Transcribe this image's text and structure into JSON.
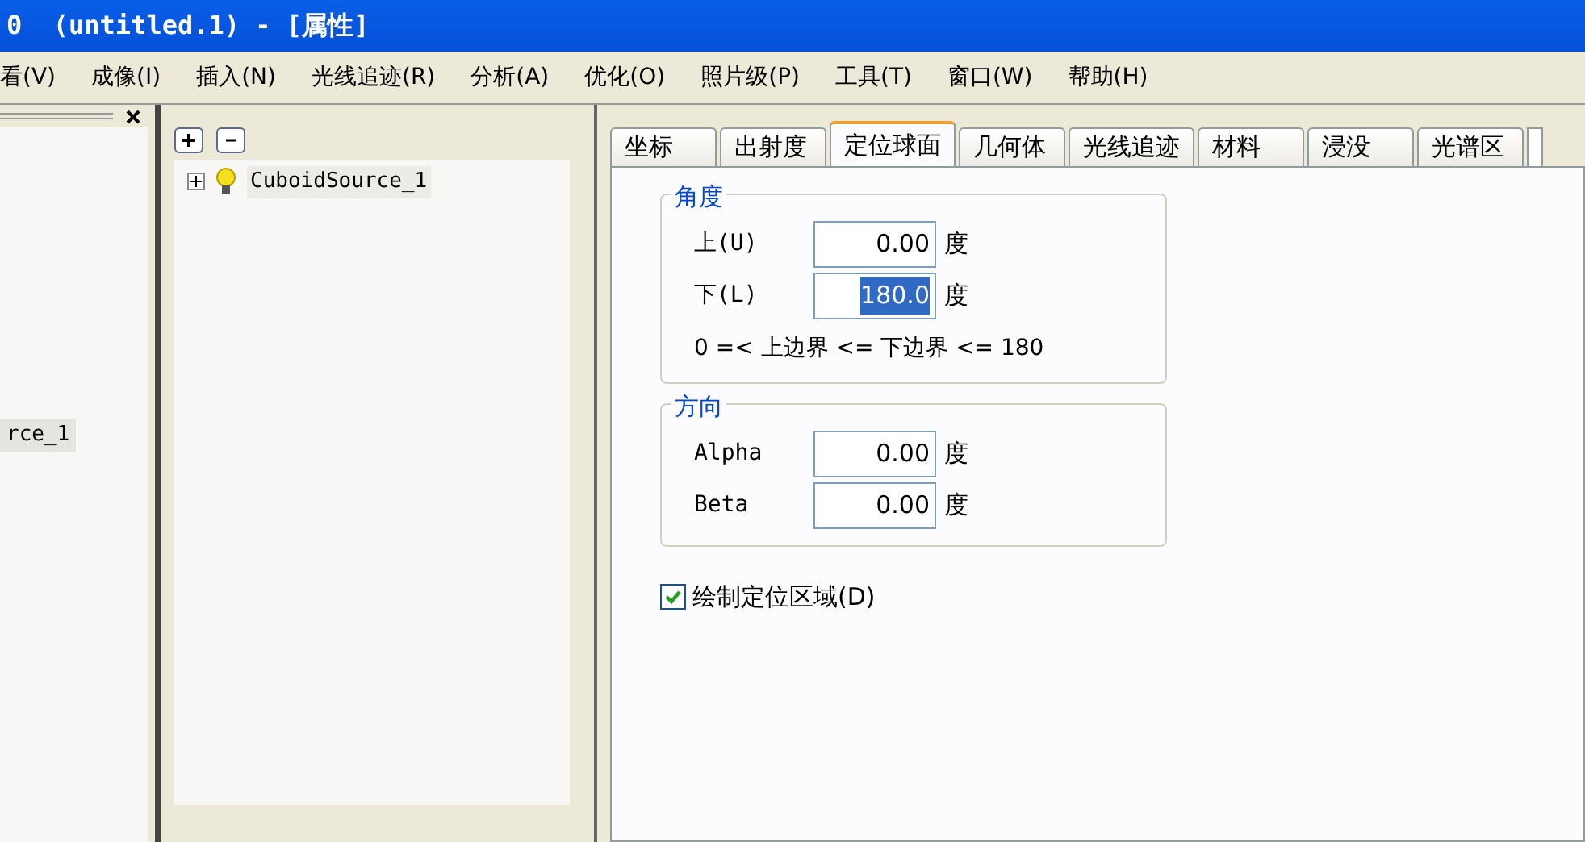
{
  "window": {
    "title": "0  (untitled.1) - [属性]"
  },
  "menu": [
    "看(V)",
    "成像(I)",
    "插入(N)",
    "光线追迹(R)",
    "分析(A)",
    "优化(O)",
    "照片级(P)",
    "工具(T)",
    "窗口(W)",
    "帮助(H)"
  ],
  "left_pane": {
    "item": "rce_1",
    "selected": true
  },
  "tree": {
    "items": [
      {
        "label": "CuboidSource_1",
        "expanded": false,
        "selected": false
      }
    ]
  },
  "tabs": [
    {
      "label": "坐标",
      "selected": false
    },
    {
      "label": "出射度",
      "selected": false
    },
    {
      "label": "定位球面",
      "selected": true
    },
    {
      "label": "几何体",
      "selected": false
    },
    {
      "label": "光线追迹",
      "selected": false
    },
    {
      "label": "材料",
      "selected": false
    },
    {
      "label": "浸没",
      "selected": false
    },
    {
      "label": "光谱区",
      "selected": false
    }
  ],
  "groups": [
    {
      "title": "角度",
      "fields": [
        {
          "label": "上(U)",
          "value": "0.00",
          "unit": "度",
          "selected": false
        },
        {
          "label": "下(L)",
          "value": "180.0",
          "unit": "度",
          "selected": true
        }
      ],
      "note": "0 =< 上边界 <= 下边界 <= 180"
    },
    {
      "title": "方向",
      "fields": [
        {
          "label": "Alpha",
          "value": "0.00",
          "unit": "度",
          "selected": false
        },
        {
          "label": "Beta",
          "value": "0.00",
          "unit": "度",
          "selected": false
        }
      ]
    }
  ],
  "checkbox": {
    "label": "绘制定位区域(D)",
    "checked": true
  }
}
